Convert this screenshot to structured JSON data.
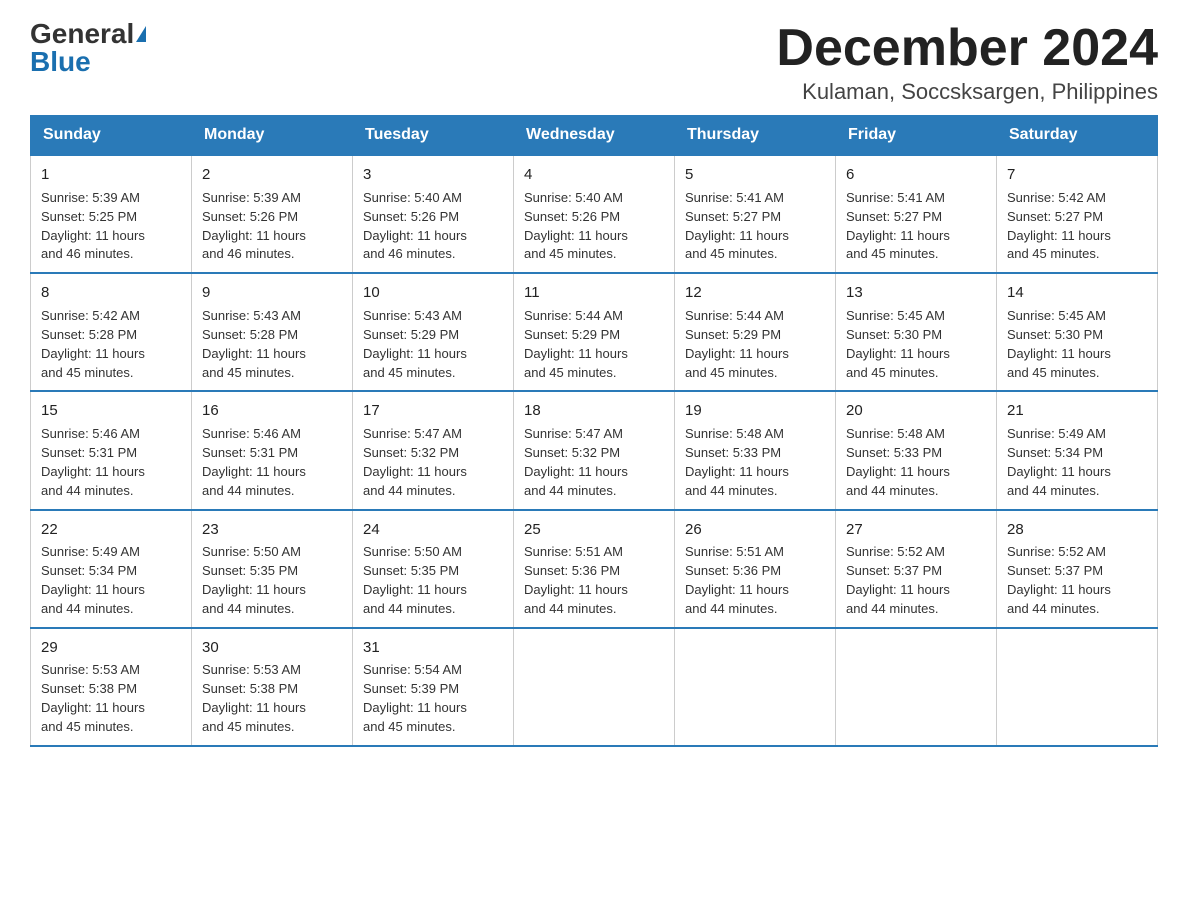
{
  "logo": {
    "general": "General",
    "blue": "Blue"
  },
  "title": "December 2024",
  "location": "Kulaman, Soccsksargen, Philippines",
  "weekdays": [
    "Sunday",
    "Monday",
    "Tuesday",
    "Wednesday",
    "Thursday",
    "Friday",
    "Saturday"
  ],
  "weeks": [
    [
      {
        "day": "1",
        "sunrise": "5:39 AM",
        "sunset": "5:25 PM",
        "daylight": "11 hours and 46 minutes."
      },
      {
        "day": "2",
        "sunrise": "5:39 AM",
        "sunset": "5:26 PM",
        "daylight": "11 hours and 46 minutes."
      },
      {
        "day": "3",
        "sunrise": "5:40 AM",
        "sunset": "5:26 PM",
        "daylight": "11 hours and 46 minutes."
      },
      {
        "day": "4",
        "sunrise": "5:40 AM",
        "sunset": "5:26 PM",
        "daylight": "11 hours and 45 minutes."
      },
      {
        "day": "5",
        "sunrise": "5:41 AM",
        "sunset": "5:27 PM",
        "daylight": "11 hours and 45 minutes."
      },
      {
        "day": "6",
        "sunrise": "5:41 AM",
        "sunset": "5:27 PM",
        "daylight": "11 hours and 45 minutes."
      },
      {
        "day": "7",
        "sunrise": "5:42 AM",
        "sunset": "5:27 PM",
        "daylight": "11 hours and 45 minutes."
      }
    ],
    [
      {
        "day": "8",
        "sunrise": "5:42 AM",
        "sunset": "5:28 PM",
        "daylight": "11 hours and 45 minutes."
      },
      {
        "day": "9",
        "sunrise": "5:43 AM",
        "sunset": "5:28 PM",
        "daylight": "11 hours and 45 minutes."
      },
      {
        "day": "10",
        "sunrise": "5:43 AM",
        "sunset": "5:29 PM",
        "daylight": "11 hours and 45 minutes."
      },
      {
        "day": "11",
        "sunrise": "5:44 AM",
        "sunset": "5:29 PM",
        "daylight": "11 hours and 45 minutes."
      },
      {
        "day": "12",
        "sunrise": "5:44 AM",
        "sunset": "5:29 PM",
        "daylight": "11 hours and 45 minutes."
      },
      {
        "day": "13",
        "sunrise": "5:45 AM",
        "sunset": "5:30 PM",
        "daylight": "11 hours and 45 minutes."
      },
      {
        "day": "14",
        "sunrise": "5:45 AM",
        "sunset": "5:30 PM",
        "daylight": "11 hours and 45 minutes."
      }
    ],
    [
      {
        "day": "15",
        "sunrise": "5:46 AM",
        "sunset": "5:31 PM",
        "daylight": "11 hours and 44 minutes."
      },
      {
        "day": "16",
        "sunrise": "5:46 AM",
        "sunset": "5:31 PM",
        "daylight": "11 hours and 44 minutes."
      },
      {
        "day": "17",
        "sunrise": "5:47 AM",
        "sunset": "5:32 PM",
        "daylight": "11 hours and 44 minutes."
      },
      {
        "day": "18",
        "sunrise": "5:47 AM",
        "sunset": "5:32 PM",
        "daylight": "11 hours and 44 minutes."
      },
      {
        "day": "19",
        "sunrise": "5:48 AM",
        "sunset": "5:33 PM",
        "daylight": "11 hours and 44 minutes."
      },
      {
        "day": "20",
        "sunrise": "5:48 AM",
        "sunset": "5:33 PM",
        "daylight": "11 hours and 44 minutes."
      },
      {
        "day": "21",
        "sunrise": "5:49 AM",
        "sunset": "5:34 PM",
        "daylight": "11 hours and 44 minutes."
      }
    ],
    [
      {
        "day": "22",
        "sunrise": "5:49 AM",
        "sunset": "5:34 PM",
        "daylight": "11 hours and 44 minutes."
      },
      {
        "day": "23",
        "sunrise": "5:50 AM",
        "sunset": "5:35 PM",
        "daylight": "11 hours and 44 minutes."
      },
      {
        "day": "24",
        "sunrise": "5:50 AM",
        "sunset": "5:35 PM",
        "daylight": "11 hours and 44 minutes."
      },
      {
        "day": "25",
        "sunrise": "5:51 AM",
        "sunset": "5:36 PM",
        "daylight": "11 hours and 44 minutes."
      },
      {
        "day": "26",
        "sunrise": "5:51 AM",
        "sunset": "5:36 PM",
        "daylight": "11 hours and 44 minutes."
      },
      {
        "day": "27",
        "sunrise": "5:52 AM",
        "sunset": "5:37 PM",
        "daylight": "11 hours and 44 minutes."
      },
      {
        "day": "28",
        "sunrise": "5:52 AM",
        "sunset": "5:37 PM",
        "daylight": "11 hours and 44 minutes."
      }
    ],
    [
      {
        "day": "29",
        "sunrise": "5:53 AM",
        "sunset": "5:38 PM",
        "daylight": "11 hours and 45 minutes."
      },
      {
        "day": "30",
        "sunrise": "5:53 AM",
        "sunset": "5:38 PM",
        "daylight": "11 hours and 45 minutes."
      },
      {
        "day": "31",
        "sunrise": "5:54 AM",
        "sunset": "5:39 PM",
        "daylight": "11 hours and 45 minutes."
      },
      {
        "day": "",
        "sunrise": "",
        "sunset": "",
        "daylight": ""
      },
      {
        "day": "",
        "sunrise": "",
        "sunset": "",
        "daylight": ""
      },
      {
        "day": "",
        "sunrise": "",
        "sunset": "",
        "daylight": ""
      },
      {
        "day": "",
        "sunrise": "",
        "sunset": "",
        "daylight": ""
      }
    ]
  ],
  "labels": {
    "sunrise": "Sunrise:",
    "sunset": "Sunset:",
    "daylight": "Daylight:"
  }
}
